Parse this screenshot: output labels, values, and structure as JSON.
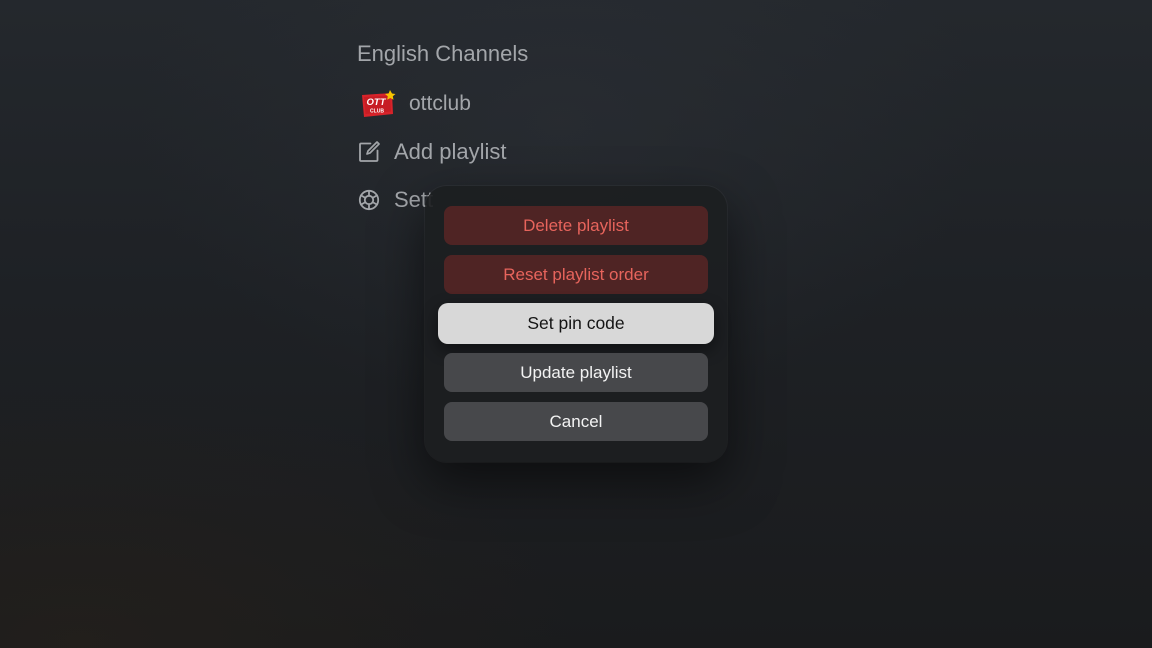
{
  "background_list": {
    "heading": "English Channels",
    "items": [
      {
        "label": "ottclub",
        "icon": "ottclub-logo",
        "logo_text_top": "OTT",
        "logo_text_bottom": "CLUB"
      },
      {
        "label": "Add playlist",
        "icon": "edit-square-icon"
      },
      {
        "label": "Sett",
        "icon": "gear-icon"
      }
    ]
  },
  "action_sheet": {
    "buttons": [
      {
        "label": "Delete playlist",
        "style": "destructive"
      },
      {
        "label": "Reset playlist order",
        "style": "destructive"
      },
      {
        "label": "Set pin code",
        "style": "focused"
      },
      {
        "label": "Update playlist",
        "style": "normal"
      },
      {
        "label": "Cancel",
        "style": "normal"
      }
    ]
  },
  "colors": {
    "destructive_text": "#e7645c",
    "destructive_bg": "#4f2424",
    "normal_bg": "#47484b",
    "focused_bg": "#d8d8d8",
    "list_text": "#a3a6aa",
    "logo_red": "#d8232a",
    "logo_yellow": "#f6c400"
  }
}
